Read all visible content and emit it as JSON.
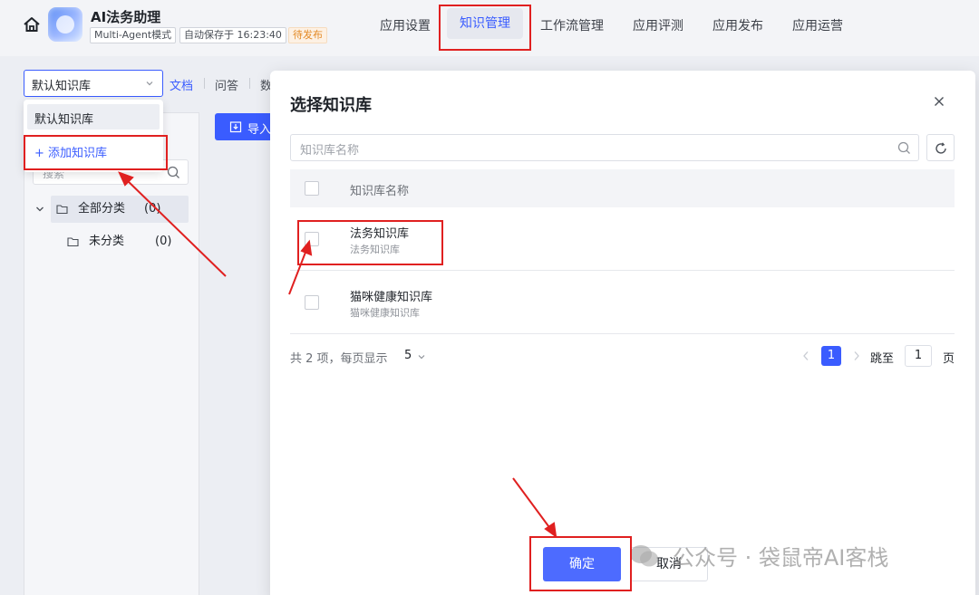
{
  "header": {
    "app_name": "AI法务助理",
    "mode_tag": "Multi-Agent模式",
    "autosave": "自动保存于 16:23:40",
    "status": "待发布",
    "nav": [
      "应用设置",
      "知识管理",
      "工作流管理",
      "应用评测",
      "应用发布",
      "应用运营"
    ],
    "active_nav": "知识管理"
  },
  "kb": {
    "selected": "默认知识库",
    "subtabs": [
      "文档",
      "问答",
      "数"
    ],
    "dropdown_option": "默认知识库",
    "add_label": "+ 添加知识库",
    "import_label": "导入",
    "search_placeholder": "搜索",
    "tree": {
      "all_label": "全部分类",
      "all_count": "(0)",
      "uncat_label": "未分类",
      "uncat_count": "(0)"
    }
  },
  "modal": {
    "title": "选择知识库",
    "search_placeholder": "知识库名称",
    "column_header": "知识库名称",
    "rows": [
      {
        "name": "法务知识库",
        "desc": "法务知识库"
      },
      {
        "name": "猫咪健康知识库",
        "desc": "猫咪健康知识库"
      }
    ],
    "pagination": {
      "total": "共 2 项，每页显示",
      "page_size": "5",
      "current": "1",
      "jump_label": "跳至",
      "jump_value": "1",
      "page_label": "页"
    },
    "ok": "确定",
    "cancel": "取消"
  },
  "watermark": "公众号 · 袋鼠帝AI客栈",
  "colors": {
    "accent": "#3a5cff",
    "annotation": "#e02020",
    "pending": "#e38a26"
  }
}
